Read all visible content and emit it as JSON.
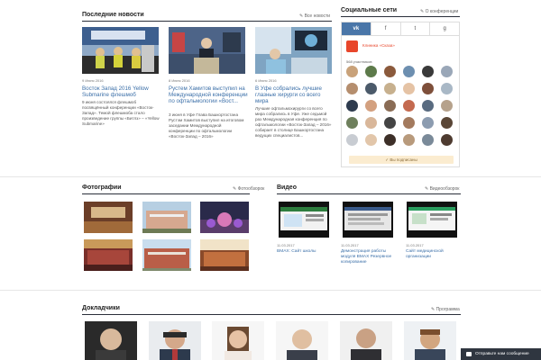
{
  "news": {
    "title": "Последние новости",
    "link": "✎ Все новости",
    "items": [
      {
        "date": "9 Июня 2016",
        "title": "Восток Запад 2016 Yellow Submarine флешмоб",
        "text": "9 июня состоялся флешмоб посвящённый конференции «Восток-Запад». Темой флешмоба стало произведение группы «Битлз» – «Yellow Submarine»"
      },
      {
        "date": "8 Июня 2016",
        "title": "Рустем Хамитов выступил на Международной конференции по офтальмологии «Вост...",
        "text": "3 июня в Уфе Глава Башкортостана Рустэм Хамитов выступил на итоговом заседании Международной конференции по офтальмологии «Восток-Запад – 2016»"
      },
      {
        "date": "6 Июня 2016",
        "title": "В Уфе собрались лучшие глазные хирурги со всего мира",
        "text": "Лучшие офтальмохирурги со всего мира собрались в Уфе. Уже седьмой раз Международная конференция по офтальмологии «Восток-Запад – 2016» собирает в столице Башкортостана ведущих специалистов..."
      }
    ]
  },
  "social": {
    "title": "Социальные сети",
    "link": "✎ О конференции",
    "tabs": [
      "vk",
      "f",
      "t",
      "g"
    ],
    "group_name": "Клиника «Сказа»",
    "members": "568 участников",
    "subscribed": "✓ Вы подписаны"
  },
  "photos": {
    "title": "Фотографии",
    "link": "✎ Фотообзорок"
  },
  "video": {
    "title": "Видео",
    "link": "✎ Видеообзорок",
    "items": [
      {
        "date": "11.03.2017",
        "title": "ВМАХ: Сайт школы"
      },
      {
        "date": "11.03.2017",
        "title": "Демонстрация работы модуля ВМАХ Резервное копирование"
      },
      {
        "date": "11.03.2017",
        "title": "Сайт медицинской организации"
      }
    ]
  },
  "speakers": {
    "title": "Докладчики",
    "link": "✎ Программа"
  },
  "message_button": "Отправьте нам сообщение",
  "colors": {
    "link_blue": "#3b6fa8",
    "vk_blue": "#4a76a8",
    "accent_orange": "#e8462b",
    "dark": "#2f3640"
  }
}
